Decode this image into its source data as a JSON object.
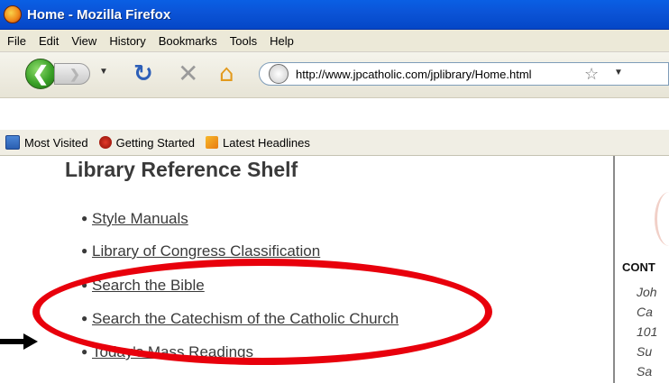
{
  "window": {
    "title": "Home - Mozilla Firefox"
  },
  "menu": {
    "items": [
      "File",
      "Edit",
      "View",
      "History",
      "Bookmarks",
      "Tools",
      "Help"
    ]
  },
  "navbar": {
    "back_icon": "back-arrow-icon",
    "forward_icon": "forward-arrow-icon",
    "reload_icon": "reload-icon",
    "stop_icon": "stop-icon",
    "home_icon": "home-icon",
    "url": "http://www.jpcatholic.com/jplibrary/Home.html"
  },
  "bookmarks": {
    "items": [
      "Most Visited",
      "Getting Started",
      "Latest Headlines"
    ]
  },
  "page": {
    "title": "Library Reference Shelf",
    "links": [
      "Style Manuals",
      "Library of Congress Classification",
      "Search the Bible",
      "Search the Catechism of the Catholic Church",
      "Today's Mass Readings"
    ]
  },
  "sidebar": {
    "heading": "CONT",
    "lines": [
      "Joh",
      "Ca",
      "101",
      "Su",
      "Sa"
    ]
  },
  "colors": {
    "titlebar": "#0b53d6",
    "annotation_ellipse": "#e8000c",
    "text": "#3a3a3a"
  }
}
